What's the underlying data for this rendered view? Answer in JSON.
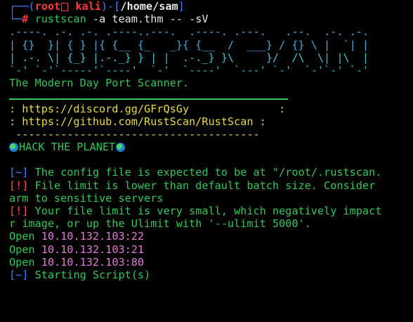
{
  "prompt": {
    "corner_top": "┌──(",
    "user": "root",
    "host": "kali",
    "mid": ")-[",
    "path": "/home/sam",
    "end": "]",
    "corner_bottom": "└─",
    "hash": "#",
    "command": "rustscan",
    "args": "-a team.thm -- -sV"
  },
  "banner": {
    "line1": ".----. .-. .-. .----..---.  .----. .---.   .--.  .-. .-.",
    "line2": "| {}  }| { } |{ {__ {_   _}{ {__  /  ___} / {} \\ |  `| |",
    "line3": "| .-. \\| {_} |.-._} } | |  .-._} }\\     }/  /\\  \\| |\\  |",
    "line4": "`-' `-'`-----'`----'  `-'  `----'  `---' `-'  `-'`-' `-'",
    "tagline": "The Modern Day Port Scanner."
  },
  "links": {
    "discord": ": https://discord.gg/GFrQsGy              :",
    "github": ": https://github.com/RustScan/RustScan :",
    "divider": " --------------------------------------",
    "hack": "HACK THE PLANET"
  },
  "output": {
    "l1_tag": "[~]",
    "l1_text": " The config file is expected to be at \"/root/.rustscan.",
    "l2_tag": "[!]",
    "l2_text": " File limit is lower than default batch size. Consider",
    "l3_text": "arm to sensitive servers",
    "l4_tag": "[!]",
    "l4_text": " Your file limit is very small, which negatively impact",
    "l5_text": "r image, or up the Ulimit with '--ulimit 5000'.",
    "open_label": "Open",
    "ports": [
      "10.10.132.103:22",
      "10.10.132.103:21",
      "10.10.132.103:80"
    ],
    "last_tag": "[~]",
    "last_text": " Starting Script(s)"
  },
  "colors": {
    "background": "#000000",
    "prompt_blue": "#3d7fff",
    "root_red": "#ff3b3b",
    "output_green": "#34c759",
    "ip_magenta": "#e07bd6",
    "banner_cyan": "#3fb7e0"
  },
  "icons": {
    "skull": "skull-icon",
    "globe": "globe-icon"
  }
}
